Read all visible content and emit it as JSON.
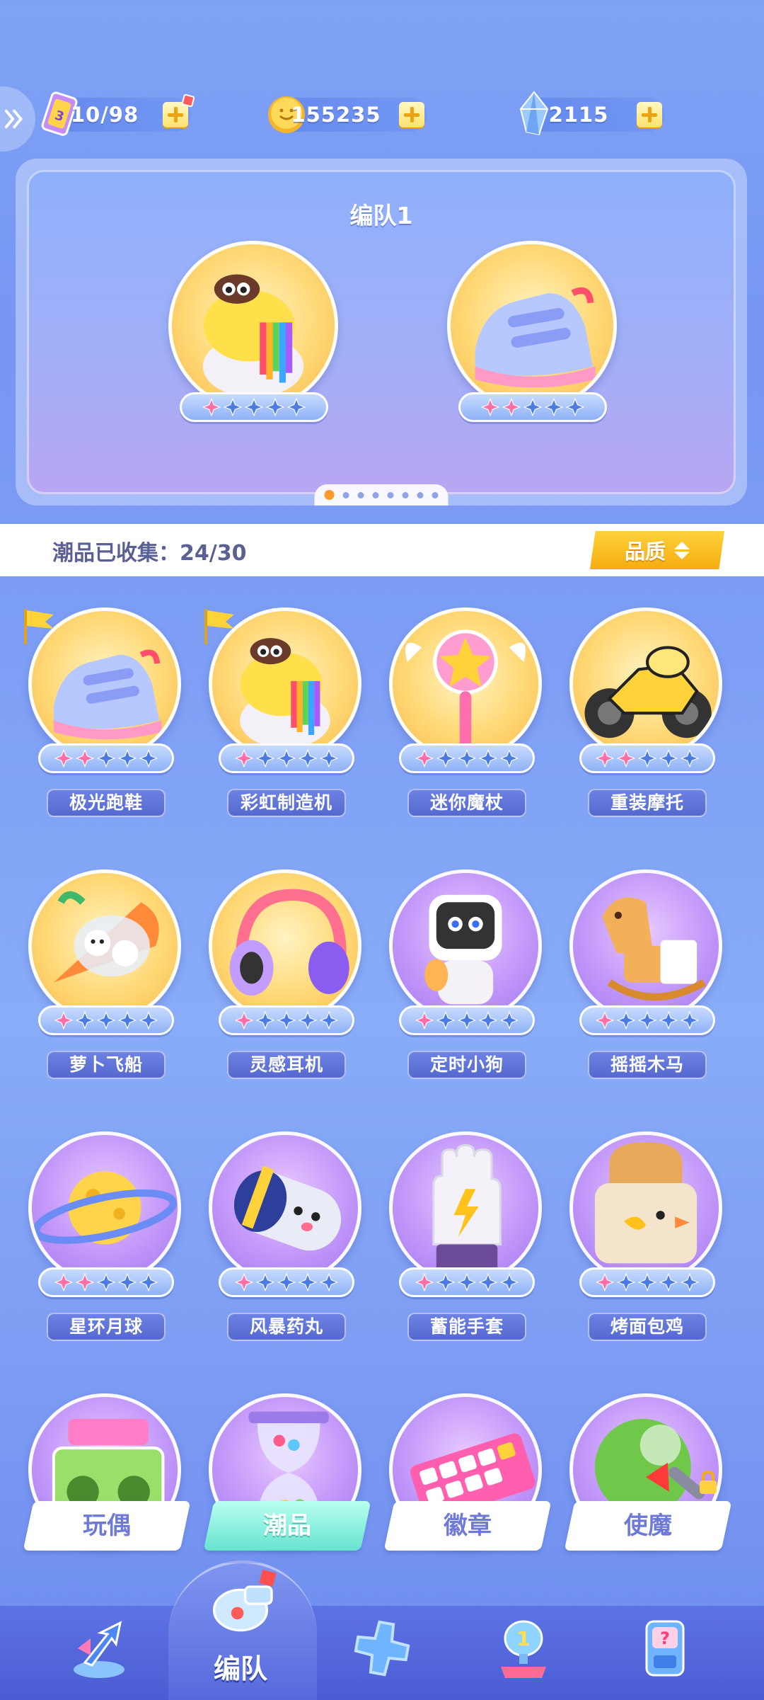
{
  "currencies": [
    {
      "name": "stamina",
      "value": "10/98",
      "icon": "ticket-icon"
    },
    {
      "name": "coins",
      "value": "155235",
      "icon": "coin-icon"
    },
    {
      "name": "diamonds",
      "value": "2115",
      "icon": "crystal-icon"
    }
  ],
  "team": {
    "title": "编队1",
    "slots": [
      {
        "item": "彩虹制造机",
        "stars_filled": 1,
        "stars_total": 5
      },
      {
        "item": "极光跑鞋",
        "stars_filled": 2,
        "stars_total": 5
      }
    ],
    "page_count": 8,
    "page_active": 1
  },
  "collection": {
    "label": "潮品已收集：24/30",
    "sort_label": "品质"
  },
  "items": [
    {
      "name": "极光跑鞋",
      "stars_filled": 2,
      "frame": "gold",
      "flag": true
    },
    {
      "name": "彩虹制造机",
      "stars_filled": 1,
      "frame": "gold",
      "flag": true
    },
    {
      "name": "迷你魔杖",
      "stars_filled": 1,
      "frame": "gold",
      "flag": false
    },
    {
      "name": "重装摩托",
      "stars_filled": 2,
      "frame": "gold",
      "flag": false
    },
    {
      "name": "萝卜飞船",
      "stars_filled": 1,
      "frame": "gold",
      "flag": false
    },
    {
      "name": "灵感耳机",
      "stars_filled": 1,
      "frame": "gold",
      "flag": false
    },
    {
      "name": "定时小狗",
      "stars_filled": 1,
      "frame": "purple",
      "flag": false
    },
    {
      "name": "摇摇木马",
      "stars_filled": 1,
      "frame": "purple",
      "flag": false
    },
    {
      "name": "星环月球",
      "stars_filled": 2,
      "frame": "purple",
      "flag": false
    },
    {
      "name": "风暴药丸",
      "stars_filled": 1,
      "frame": "purple",
      "flag": false
    },
    {
      "name": "蓄能手套",
      "stars_filled": 1,
      "frame": "purple",
      "flag": false
    },
    {
      "name": "烤面包鸡",
      "stars_filled": 1,
      "frame": "purple",
      "flag": false
    }
  ],
  "categories": [
    {
      "label": "玩偶",
      "active": false,
      "locked": false
    },
    {
      "label": "潮品",
      "active": true,
      "locked": false
    },
    {
      "label": "徽章",
      "active": false,
      "locked": false
    },
    {
      "label": "使魔",
      "active": false,
      "locked": true
    }
  ],
  "nav": {
    "active_label": "编队",
    "items": [
      "arrow-icon",
      "whistle-icon",
      "gamepad-icon",
      "trophy-icon",
      "mystery-machine-icon"
    ]
  },
  "colors": {
    "accent_gold": "#f5ac10",
    "star_filled": "#ff6fa8",
    "star_empty": "#4d7be6",
    "active_tab": "#67e3d0"
  }
}
